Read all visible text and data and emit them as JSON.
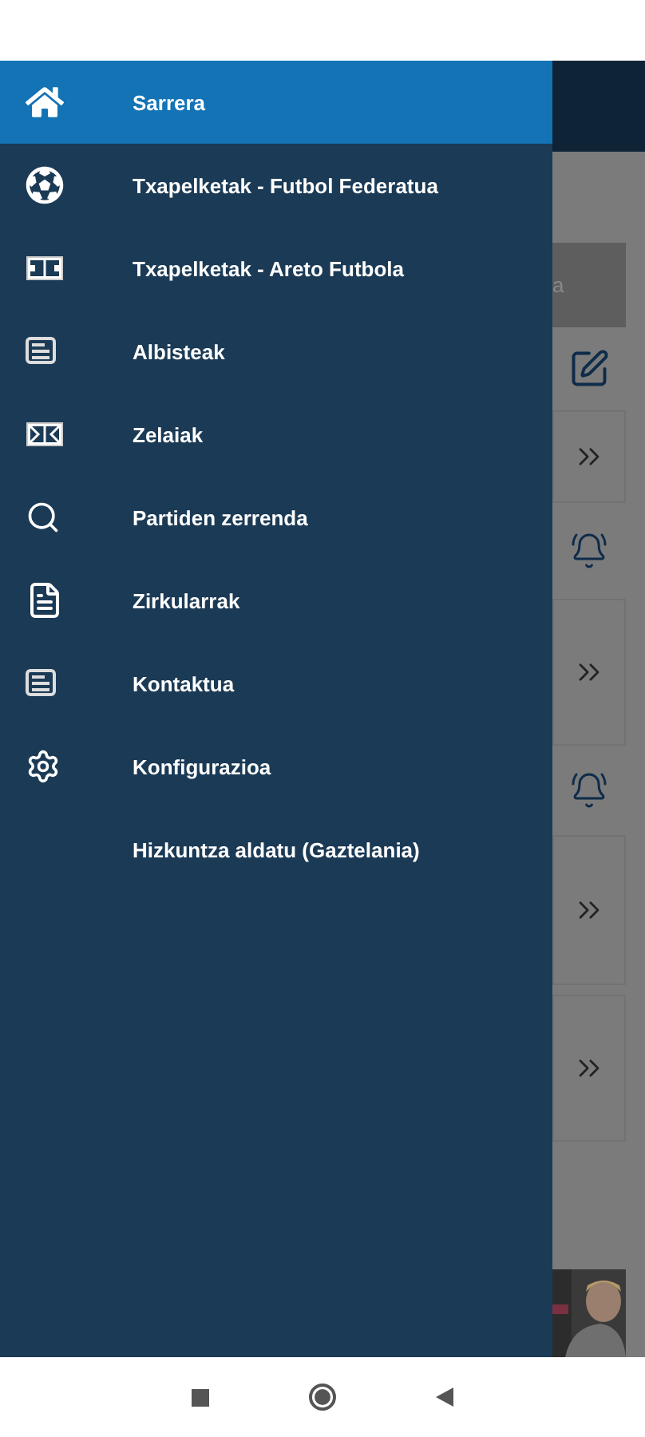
{
  "drawer": {
    "items": [
      {
        "label": "Sarrera",
        "selected": true
      },
      {
        "label": "Txapelketak - Futbol Federatua",
        "selected": false
      },
      {
        "label": "Txapelketak - Areto Futbola",
        "selected": false
      },
      {
        "label": "Albisteak",
        "selected": false
      },
      {
        "label": "Zelaiak",
        "selected": false
      },
      {
        "label": "Partiden zerrenda",
        "selected": false
      },
      {
        "label": "Zirkularrak",
        "selected": false
      },
      {
        "label": "Kontaktua",
        "selected": false
      },
      {
        "label": "Konfigurazioa",
        "selected": false
      },
      {
        "label": "Hizkuntza aldatu (Gaztelania)",
        "selected": false
      }
    ]
  },
  "backdrop": {
    "bar_text": "a"
  }
}
